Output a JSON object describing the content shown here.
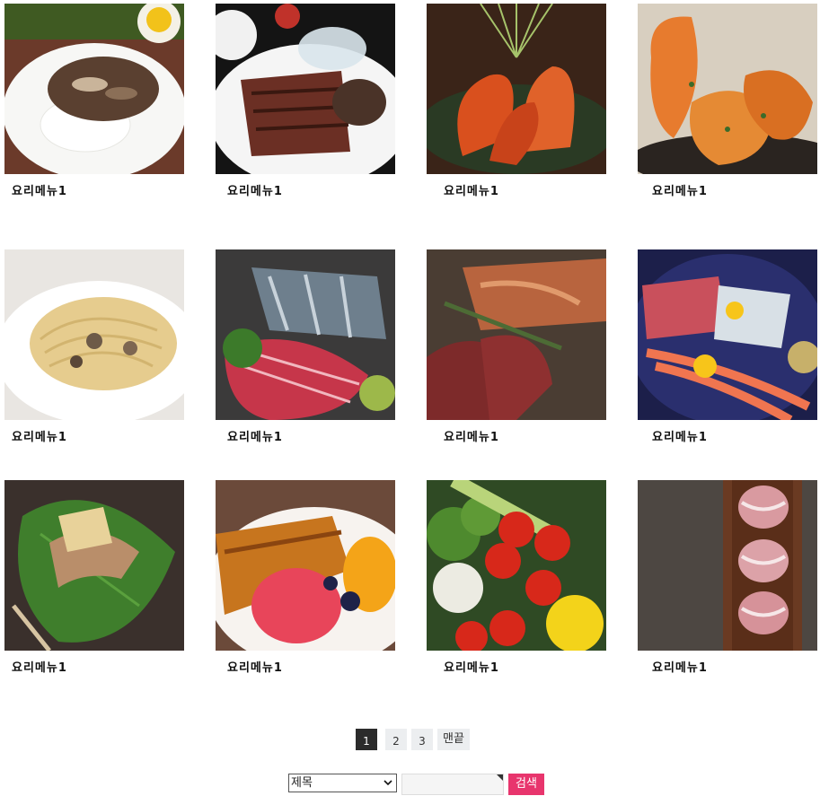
{
  "gallery": {
    "items": [
      {
        "caption": "요리메뉴1",
        "photo": "mushroom-rice-plate"
      },
      {
        "caption": "요리메뉴1",
        "photo": "grilled-steak"
      },
      {
        "caption": "요리메뉴1",
        "photo": "grilled-prawns"
      },
      {
        "caption": "요리메뉴1",
        "photo": "fried-shrimp"
      },
      {
        "caption": "요리메뉴1",
        "photo": "mushroom-pasta"
      },
      {
        "caption": "요리메뉴1",
        "photo": "sashimi-platter"
      },
      {
        "caption": "요리메뉴1",
        "photo": "smoked-duck"
      },
      {
        "caption": "요리메뉴1",
        "photo": "sashimi-shrimp-plate"
      },
      {
        "caption": "요리메뉴1",
        "photo": "perilla-leaf-wrap"
      },
      {
        "caption": "요리메뉴1",
        "photo": "cake-sorbet-dessert"
      },
      {
        "caption": "요리메뉴1",
        "photo": "fresh-vegetables"
      },
      {
        "caption": "요리메뉴1",
        "photo": "raw-pork-belly"
      }
    ]
  },
  "pagination": {
    "pages": [
      "1",
      "2",
      "3"
    ],
    "current": "1",
    "last_label": "맨끝"
  },
  "search": {
    "field_select": "제목",
    "query": "",
    "submit_label": "검색"
  },
  "colors": {
    "accent": "#e8356d",
    "page_active": "#2b2b2b",
    "page_idle": "#eceef0"
  }
}
